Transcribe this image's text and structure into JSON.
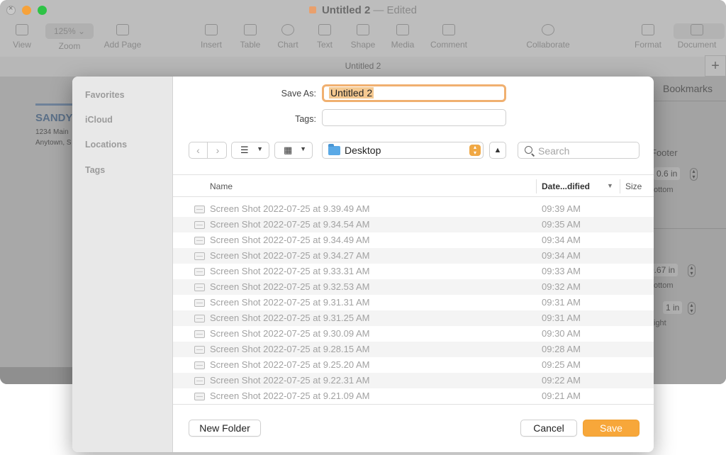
{
  "window": {
    "title": "Untitled 2",
    "status": "— Edited",
    "tab_title": "Untitled 2",
    "zoom": "125%",
    "colors": {
      "accent": "#f7a73a",
      "folder": "#5aa9e6",
      "close": "#c9c9c9",
      "minimize": "#f6a23a",
      "zoom": "#2ec346"
    }
  },
  "toolbar": {
    "items": [
      {
        "label": "View",
        "icon": "sidebar-icon"
      },
      {
        "label": "Zoom",
        "icon": "zoom-icon"
      },
      {
        "label": "Add Page",
        "icon": "add-page-icon"
      },
      {
        "label": "Insert",
        "icon": "insert-icon"
      },
      {
        "label": "Table",
        "icon": "table-icon"
      },
      {
        "label": "Chart",
        "icon": "chart-icon"
      },
      {
        "label": "Text",
        "icon": "text-icon"
      },
      {
        "label": "Shape",
        "icon": "shape-icon"
      },
      {
        "label": "Media",
        "icon": "media-icon"
      },
      {
        "label": "Comment",
        "icon": "comment-icon"
      },
      {
        "label": "Collaborate",
        "icon": "collaborate-icon"
      },
      {
        "label": "Format",
        "icon": "format-icon"
      },
      {
        "label": "Document",
        "icon": "document-icon"
      }
    ]
  },
  "document": {
    "name": "SANDY",
    "address1": "1234 Main",
    "address2": "Anytown, S"
  },
  "inspector": {
    "tab": "Bookmarks",
    "footer": "Footer",
    "value1": "0.6 in",
    "label1": "ottom",
    "value2": "0.67 in",
    "label2": "ottom",
    "value3": "1 in",
    "label3": "ight"
  },
  "dialog": {
    "sidebar": [
      "Favorites",
      "iCloud",
      "Locations",
      "Tags"
    ],
    "save_as_label": "Save As:",
    "save_as_value": "Untitled 2",
    "tags_label": "Tags:",
    "location": "Desktop",
    "search_placeholder": "Search",
    "columns": {
      "name": "Name",
      "date": "Date...dified",
      "size": "Size"
    },
    "files": [
      {
        "name": "Screen Shot 2022-07-25 at 9.39.49 AM",
        "time": "09:39 AM"
      },
      {
        "name": "Screen Shot 2022-07-25 at 9.34.54 AM",
        "time": "09:35 AM"
      },
      {
        "name": "Screen Shot 2022-07-25 at 9.34.49 AM",
        "time": "09:34 AM"
      },
      {
        "name": "Screen Shot 2022-07-25 at 9.34.27 AM",
        "time": "09:34 AM"
      },
      {
        "name": "Screen Shot 2022-07-25 at 9.33.31 AM",
        "time": "09:33 AM"
      },
      {
        "name": "Screen Shot 2022-07-25 at 9.32.53 AM",
        "time": "09:32 AM"
      },
      {
        "name": "Screen Shot 2022-07-25 at 9.31.31 AM",
        "time": "09:31 AM"
      },
      {
        "name": "Screen Shot 2022-07-25 at 9.31.25 AM",
        "time": "09:31 AM"
      },
      {
        "name": "Screen Shot 2022-07-25 at 9.30.09 AM",
        "time": "09:30 AM"
      },
      {
        "name": "Screen Shot 2022-07-25 at 9.28.15 AM",
        "time": "09:28 AM"
      },
      {
        "name": "Screen Shot 2022-07-25 at 9.25.20 AM",
        "time": "09:25 AM"
      },
      {
        "name": "Screen Shot 2022-07-25 at 9.22.31 AM",
        "time": "09:22 AM"
      },
      {
        "name": "Screen Shot 2022-07-25 at 9.21.09 AM",
        "time": "09:21 AM"
      }
    ],
    "new_folder_label": "New Folder",
    "cancel_label": "Cancel",
    "save_label": "Save"
  }
}
